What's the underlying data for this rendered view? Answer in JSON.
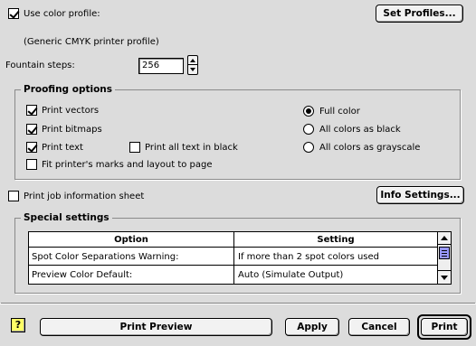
{
  "color_profile": {
    "use_label": "Use color profile:",
    "checked": true,
    "profile_name": "(Generic CMYK printer profile)",
    "set_profiles_label": "Set Profiles..."
  },
  "fountain": {
    "label": "Fountain steps:",
    "value": "256"
  },
  "proofing": {
    "title": "Proofing options",
    "print_vectors": {
      "label": "Print vectors",
      "checked": true
    },
    "print_bitmaps": {
      "label": "Print bitmaps",
      "checked": true
    },
    "print_text": {
      "label": "Print text",
      "checked": true
    },
    "print_all_text_black": {
      "label": "Print all text in black",
      "checked": false
    },
    "fit_marks": {
      "label": "Fit printer's marks and layout to page",
      "checked": false
    },
    "radios": [
      {
        "label": "Full color",
        "selected": true
      },
      {
        "label": "All colors as black",
        "selected": false
      },
      {
        "label": "All colors as grayscale",
        "selected": false
      }
    ]
  },
  "job_info": {
    "label": "Print job information sheet",
    "checked": false,
    "settings_label": "Info Settings..."
  },
  "special": {
    "title": "Special settings",
    "columns": [
      "Option",
      "Setting"
    ],
    "rows": [
      {
        "option": "Spot Color Separations Warning:",
        "setting": "If more than 2 spot colors used"
      },
      {
        "option": "Preview Color Default:",
        "setting": "Auto (Simulate Output)"
      }
    ]
  },
  "buttons": {
    "help": "?",
    "print_preview": "Print Preview",
    "apply": "Apply",
    "cancel": "Cancel",
    "print": "Print"
  },
  "colors": {
    "panel": "#dcdcdc",
    "scroll_thumb": "#9999ff",
    "help_yellow": "#ffff66"
  }
}
